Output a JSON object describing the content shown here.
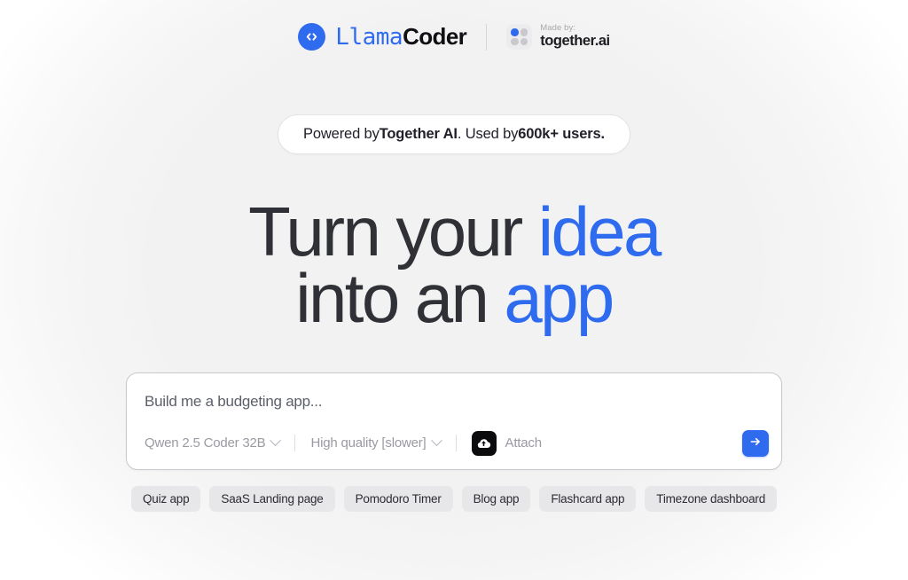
{
  "brand": {
    "logo_icon": "code-brackets-icon",
    "name_part1": "Llama",
    "name_part2": "Coder",
    "attribution": {
      "made_by_label": "Made by:",
      "company": "together.ai",
      "mark_icon": "together-dots-icon"
    }
  },
  "hero": {
    "badge": {
      "prefix": "Powered by ",
      "strong1": "Together AI",
      "middle": ". Used by ",
      "strong2": "600k+ users."
    },
    "headline": {
      "line1_plain": "Turn your ",
      "line1_accent": "idea",
      "line2_plain": "into an ",
      "line2_accent": "app"
    }
  },
  "composer": {
    "placeholder": "Build me a budgeting app...",
    "value": "",
    "model_selector": {
      "label": "Qwen 2.5 Coder 32B",
      "chevron_icon": "chevron-down-icon"
    },
    "quality_selector": {
      "label": "High quality [slower]",
      "chevron_icon": "chevron-down-icon"
    },
    "attach": {
      "label": "Attach",
      "icon": "cloud-upload-icon"
    },
    "submit": {
      "icon": "arrow-right-icon",
      "label": ""
    }
  },
  "suggestions": [
    {
      "label": "Quiz app"
    },
    {
      "label": "SaaS Landing page"
    },
    {
      "label": "Pomodoro Timer"
    },
    {
      "label": "Blog app"
    },
    {
      "label": "Flashcard app"
    },
    {
      "label": "Timezone dashboard"
    }
  ],
  "colors": {
    "accent_blue": "#2f6bef",
    "text_dark": "#2f3136",
    "muted_gray": "#9a9aa2",
    "chip_bg": "#e7e7e9",
    "page_bg": "#f2f2f2",
    "attach_black": "#0b0b0e"
  }
}
